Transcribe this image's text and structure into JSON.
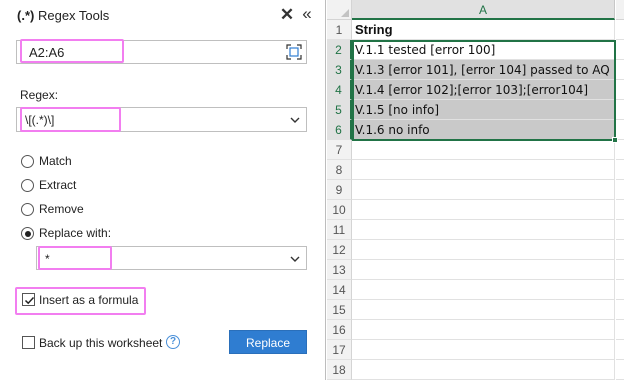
{
  "panel": {
    "title_icon": "(.*)",
    "title": "Regex Tools",
    "close_icon": "close-icon",
    "collapse_icon": "collapse-icon",
    "range": {
      "value": "A2:A6",
      "select_icon": "select-range-icon"
    },
    "regex_label": "Regex:",
    "regex_value": "\\[(.*)\\]",
    "options": [
      {
        "label": "Match",
        "checked": false
      },
      {
        "label": "Extract",
        "checked": false
      },
      {
        "label": "Remove",
        "checked": false
      },
      {
        "label": "Replace with:",
        "checked": true
      }
    ],
    "replace_value": "*",
    "insert_formula": {
      "label": "Insert as a formula",
      "checked": true
    },
    "backup": {
      "label": "Back up this worksheet",
      "checked": false
    },
    "help_icon": "?",
    "replace_button": "Replace",
    "highlight_color": "#f27ef0",
    "button_color": "#2f7dd1"
  },
  "sheet": {
    "column": "A",
    "rows": [
      {
        "num": "1",
        "value": "String"
      },
      {
        "num": "2",
        "value": "V.1.1 tested [error 100]"
      },
      {
        "num": "3",
        "value": "V.1.3 [error 101], [error 104] passed to AQ"
      },
      {
        "num": "4",
        "value": "V.1.4  [error 102];[error 103];[error104]"
      },
      {
        "num": "5",
        "value": "V.1.5 [no info]"
      },
      {
        "num": "6",
        "value": "V.1.6 no info"
      },
      {
        "num": "7",
        "value": ""
      },
      {
        "num": "8",
        "value": ""
      },
      {
        "num": "9",
        "value": ""
      },
      {
        "num": "10",
        "value": ""
      },
      {
        "num": "11",
        "value": ""
      },
      {
        "num": "12",
        "value": ""
      },
      {
        "num": "13",
        "value": ""
      },
      {
        "num": "14",
        "value": ""
      },
      {
        "num": "15",
        "value": ""
      },
      {
        "num": "16",
        "value": ""
      },
      {
        "num": "17",
        "value": ""
      },
      {
        "num": "18",
        "value": ""
      }
    ],
    "selection_color": "#217346"
  }
}
